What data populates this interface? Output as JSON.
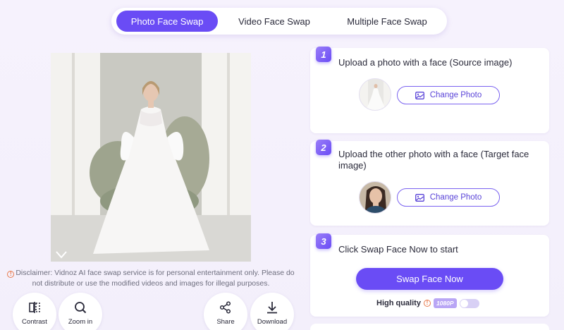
{
  "tabs": [
    {
      "label": "Photo Face Swap",
      "active": true
    },
    {
      "label": "Video Face Swap",
      "active": false
    },
    {
      "label": "Multiple Face Swap",
      "active": false
    }
  ],
  "disclaimer": "Disclaimer: Vidnoz AI face swap service is for personal entertainment only. Please do not distribute or use the modified videos and images for illegal purposes.",
  "tools": {
    "contrast": "Contrast",
    "zoom_in": "Zoom in",
    "share": "Share",
    "download": "Download"
  },
  "steps": [
    {
      "number": "1",
      "title": "Upload a photo with a face (Source image)",
      "button": "Change Photo"
    },
    {
      "number": "2",
      "title": "Upload the other photo with a face (Target face image)",
      "button": "Change Photo"
    },
    {
      "number": "3",
      "title": "Click Swap Face Now to start",
      "button": "Swap Face Now"
    }
  ],
  "quality": {
    "label": "High quality",
    "resolution": "1080P",
    "enabled": false
  },
  "colors": {
    "accent": "#6a4cf5",
    "warning": "#e87a4c"
  }
}
